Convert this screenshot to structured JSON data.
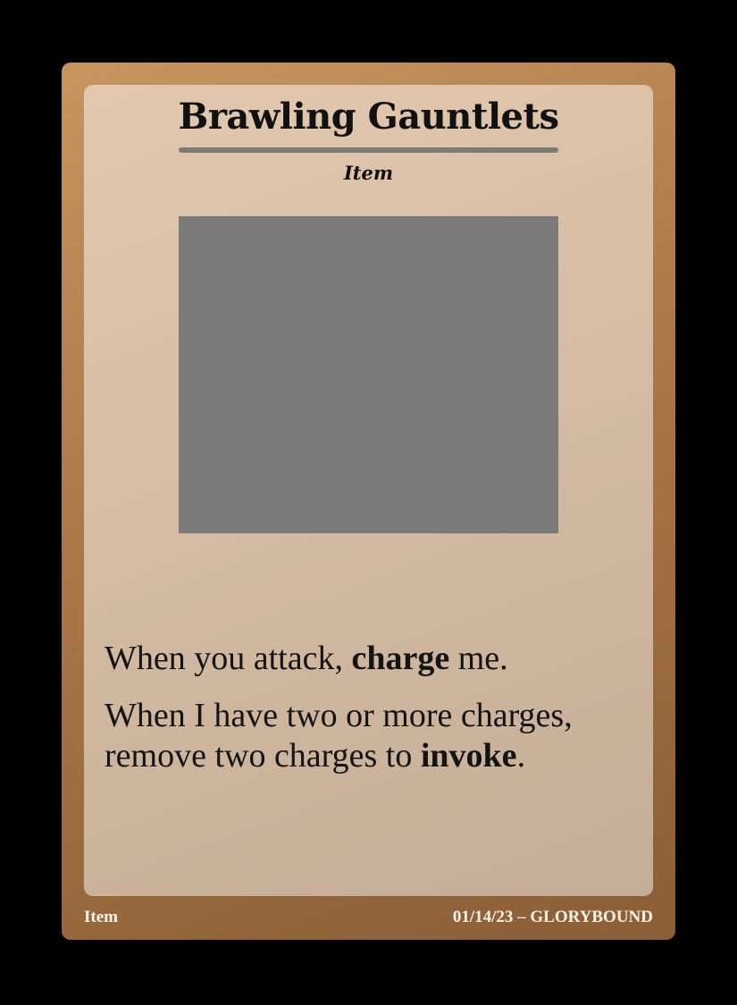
{
  "card": {
    "title": "Brawling Gauntlets",
    "type_line": "Item",
    "rules": [
      {
        "parts": [
          {
            "text": "When you attack, ",
            "bold": false
          },
          {
            "text": "charge",
            "bold": true
          },
          {
            "text": " me.",
            "bold": false
          }
        ]
      },
      {
        "parts": [
          {
            "text": "When I have two or more charges, remove two charges to ",
            "bold": false
          },
          {
            "text": "invoke",
            "bold": true
          },
          {
            "text": ".",
            "bold": false
          }
        ]
      }
    ],
    "footer": {
      "left": "Item",
      "right": "01/14/23 – GLORYBOUND"
    }
  },
  "colors": {
    "background": "#000000",
    "frame": "#ad7a4a",
    "panel": "#d5bca3",
    "art_placeholder": "#7a7a7a",
    "title_rule": "#7b7b7b",
    "footer_text": "#fbf3e6"
  }
}
